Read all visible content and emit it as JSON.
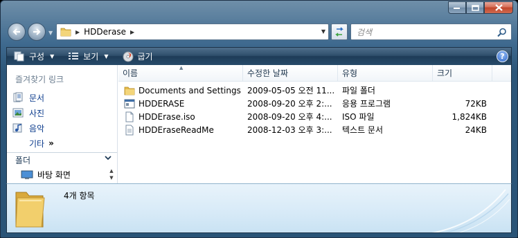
{
  "window": {
    "caption": {
      "minimize": "–",
      "maximize": "□",
      "close": "✕"
    }
  },
  "navigation": {
    "address_folder": "HDDerase",
    "search_placeholder": "검색"
  },
  "toolbar": {
    "organize_label": "구성",
    "views_label": "보기",
    "burn_label": "굽기",
    "help_label": "?"
  },
  "nav_pane": {
    "favorites_title": "즐겨찾기 링크",
    "favorites": [
      {
        "label": "문서",
        "icon": "documents-icon"
      },
      {
        "label": "사진",
        "icon": "pictures-icon"
      },
      {
        "label": "음악",
        "icon": "music-icon"
      }
    ],
    "more_label": "기타",
    "more_chevron": "»",
    "folders_label": "폴더",
    "folder_tree": [
      {
        "label": "바탕 화면",
        "icon": "desktop-icon"
      }
    ]
  },
  "file_list": {
    "columns": [
      "이름",
      "수정한 날짜",
      "유형",
      "크기"
    ],
    "rows": [
      {
        "name": "Documents and Settings",
        "modified": "2009-05-05 오전 11...",
        "type": "파일 폴더",
        "size": "",
        "icon": "folder-icon"
      },
      {
        "name": "HDDERASE",
        "modified": "2008-09-20 오후 2:...",
        "type": "응용 프로그램",
        "size": "72KB",
        "icon": "application-icon"
      },
      {
        "name": "HDDErase.iso",
        "modified": "2008-09-20 오후 4:...",
        "type": "ISO 파일",
        "size": "1,824KB",
        "icon": "file-icon"
      },
      {
        "name": "HDDEraseReadMe",
        "modified": "2008-12-03 오후 3:...",
        "type": "텍스트 문서",
        "size": "24KB",
        "icon": "text-file-icon"
      }
    ]
  },
  "details": {
    "item_count": "4개 항목"
  },
  "colors": {
    "frame": "#2c5679",
    "link": "#0b3b8c",
    "details_bg": "#d7eaf7"
  }
}
